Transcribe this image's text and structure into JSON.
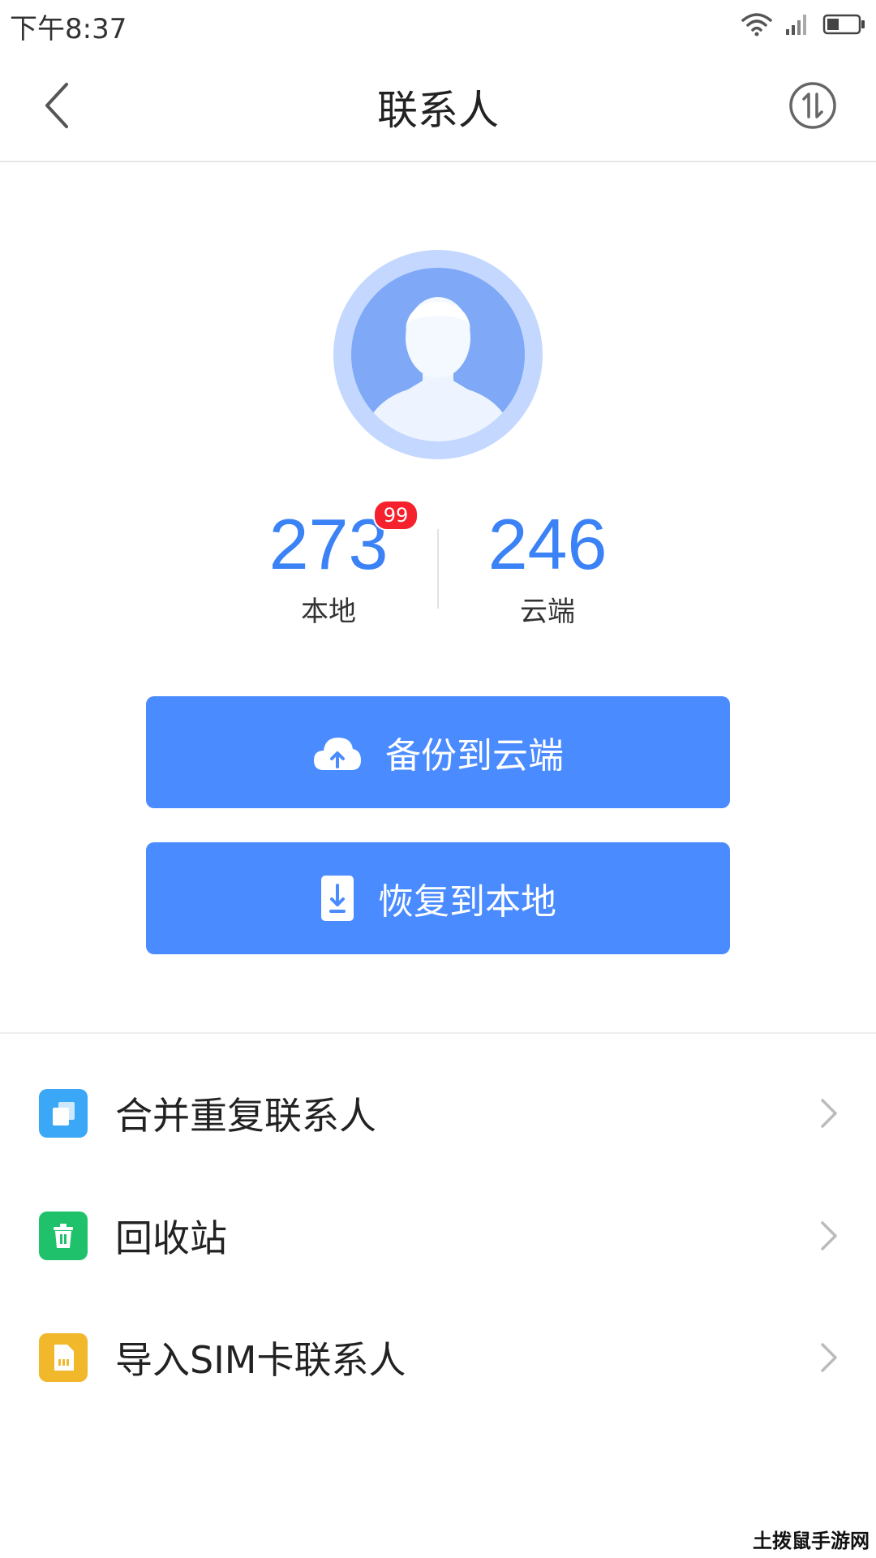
{
  "status_bar": {
    "time": "下午8:37"
  },
  "header": {
    "title": "联系人",
    "back_icon": "chevron-left-icon",
    "sync_icon": "sync-arrows-icon"
  },
  "stats": {
    "local": {
      "count": "273",
      "label": "本地",
      "badge": "99"
    },
    "cloud": {
      "count": "246",
      "label": "云端"
    }
  },
  "actions": {
    "backup_label": "备份到云端",
    "restore_label": "恢复到本地"
  },
  "menu": {
    "items": [
      {
        "label": "合并重复联系人",
        "icon": "merge-icon",
        "color": "#3aa7f7"
      },
      {
        "label": "回收站",
        "icon": "trash-icon",
        "color": "#1fc26a"
      },
      {
        "label": "导入SIM卡联系人",
        "icon": "sim-card-icon",
        "color": "#f1b82c"
      }
    ]
  },
  "watermark": "土拨鼠手游网",
  "colors": {
    "accent": "#4a8bff",
    "number": "#3b82f6",
    "badge": "#f5222d"
  }
}
